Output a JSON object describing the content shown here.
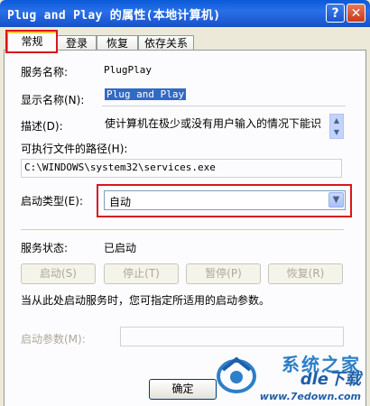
{
  "window": {
    "title": "Plug and Play 的属性(本地计算机)",
    "help_glyph": "?",
    "close_glyph": "✕"
  },
  "tabs": [
    {
      "label": "常规",
      "active": true
    },
    {
      "label": "登录",
      "active": false
    },
    {
      "label": "恢复",
      "active": false
    },
    {
      "label": "依存关系",
      "active": false
    }
  ],
  "general": {
    "service_name_label": "服务名称:",
    "service_name_value": "PlugPlay",
    "display_name_label": "显示名称(N):",
    "display_name_value": "Plug and Play",
    "description_label": "描述(D):",
    "description_value": "使计算机在极少或没有用户输入的情况下能识",
    "exe_path_label": "可执行文件的路径(H):",
    "exe_path_value": "C:\\WINDOWS\\system32\\services.exe",
    "startup_type_label": "启动类型(E):",
    "startup_type_value": "自动",
    "service_status_label": "服务状态:",
    "service_status_value": "已启动",
    "buttons": {
      "start": "启动(S)",
      "stop": "停止(T)",
      "pause": "暂停(P)",
      "resume": "恢复(R)"
    },
    "hint": "当从此处启动服务时，您可指定所适用的启动参数。",
    "start_params_label": "启动参数(M):",
    "start_params_value": ""
  },
  "footer": {
    "ok_label": "确定"
  },
  "watermark": {
    "brand": "系统之家",
    "brand2": "dle下载",
    "url": "www.7edown.com"
  },
  "colors": {
    "highlight_box": "#d9161e",
    "title_bar": "#0a5ad8",
    "selection": "#316ac5"
  }
}
